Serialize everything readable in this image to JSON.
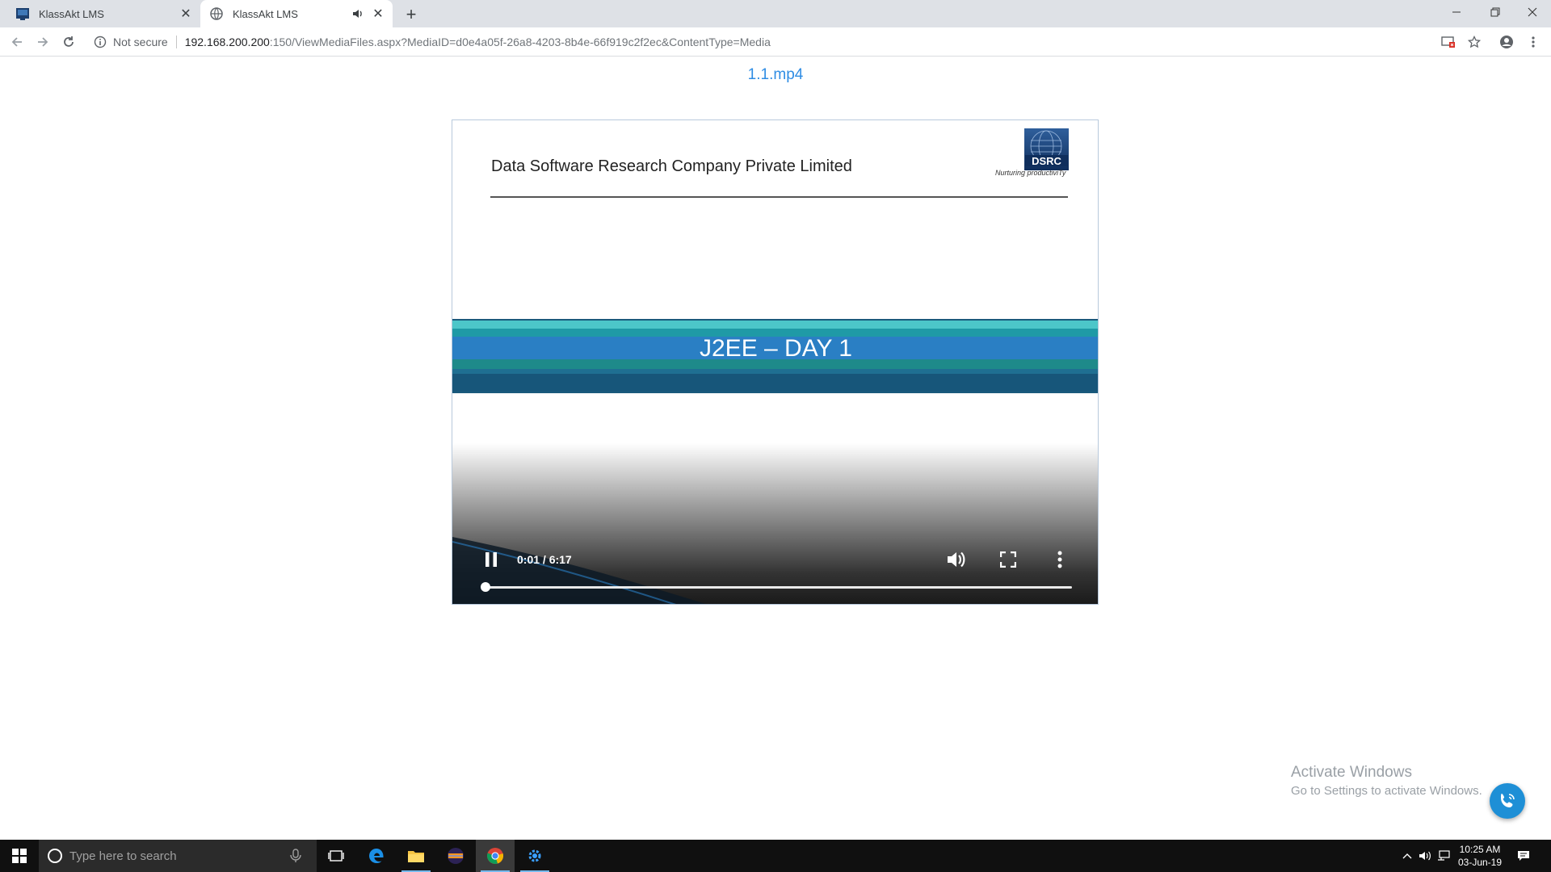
{
  "browser": {
    "tabs": [
      {
        "title": "KlassAkt LMS",
        "active": false
      },
      {
        "title": "KlassAkt LMS",
        "active": true,
        "audio_playing": true
      }
    ],
    "address": {
      "security_label": "Not secure",
      "host": "192.168.200.200",
      "path": ":150/ViewMediaFiles.aspx?MediaID=d0e4a05f-26a8-4203-8b4e-66f919c2f2ec&ContentType=Media"
    }
  },
  "page": {
    "media_title": "1.1.mp4"
  },
  "video": {
    "slide": {
      "company": "Data Software Research Company Private Limited",
      "logo_text": "DSRC",
      "logo_tagline": "Nurturing productiviTy",
      "banner_title": "J2EE – DAY 1"
    },
    "controls": {
      "time_display": "0:01 / 6:17",
      "progress_fraction": 0.003,
      "state": "playing"
    }
  },
  "watermark": {
    "title": "Activate Windows",
    "subtitle": "Go to Settings to activate Windows."
  },
  "taskbar": {
    "search_placeholder": "Type here to search",
    "clock_time": "10:25 AM",
    "clock_date": "03-Jun-19"
  },
  "colors": {
    "link_blue": "#2f8de4",
    "banner_blue": "#2a7fc4",
    "banner_teal": "#1e9a98",
    "call_button": "#1e8fd6"
  }
}
